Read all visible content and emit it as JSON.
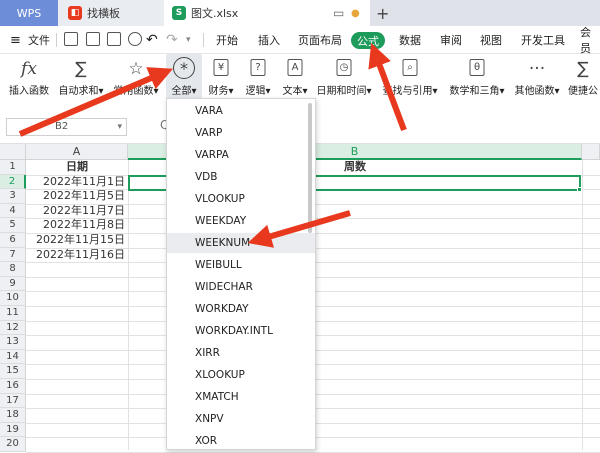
{
  "tabs": {
    "wps": "WPS",
    "doc": "找横板",
    "file": "图文.xlsx",
    "add": "+"
  },
  "menu": {
    "file": "文件",
    "items": [
      "开始",
      "插入",
      "页面布局",
      "公式",
      "数据",
      "审阅",
      "视图",
      "开发工具",
      "会员"
    ]
  },
  "ribbon": [
    "插入函数",
    "自动求和▾",
    "常用函数▾",
    "全部▾",
    "财务▾",
    "逻辑▾",
    "文本▾",
    "日期和时间▾",
    "查找与引用▾",
    "数学和三角▾",
    "其他函数▾",
    "便捷公"
  ],
  "namebox": "B2",
  "sheet": {
    "columns": [
      "A",
      "B"
    ],
    "rows": [
      "1",
      "2",
      "3",
      "4",
      "5",
      "6",
      "7",
      "8",
      "9",
      "10",
      "11",
      "12",
      "13",
      "14",
      "15",
      "16",
      "17",
      "18",
      "19",
      "20"
    ],
    "header_a": "日期",
    "header_b": "周数",
    "dates": [
      "2022年11月1日",
      "2022年11月5日",
      "2022年11月7日",
      "2022年11月8日",
      "2022年11月15日",
      "2022年11月16日"
    ]
  },
  "functions": [
    "VARA",
    "VARP",
    "VARPA",
    "VDB",
    "VLOOKUP",
    "WEEKDAY",
    "WEEKNUM",
    "WEIBULL",
    "WIDECHAR",
    "WORKDAY",
    "WORKDAY.INTL",
    "XIRR",
    "XLOOKUP",
    "XMATCH",
    "XNPV",
    "XOR"
  ],
  "highlighted_function": "WEEKNUM",
  "colors": {
    "accent": "#1e9c5c",
    "arrow": "#e8391e",
    "wps_tab": "#6d8dd8"
  }
}
